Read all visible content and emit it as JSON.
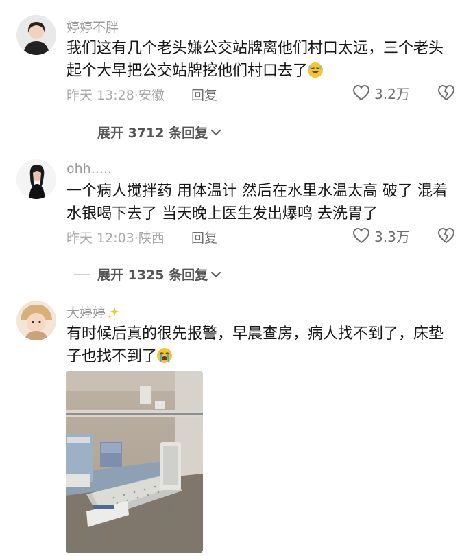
{
  "comments": [
    {
      "username": "婷婷不胖",
      "text": "我们这有几个老头嫌公交站牌离他们村口太远，三个老头起个大早把公交站牌挖他们村口去了",
      "emoji": "rofl-emoji",
      "time": "昨天 13:28",
      "location": "安徽",
      "reply_label": "回复",
      "likes": "3.2万",
      "expand_label": "展开 3712 条回复"
    },
    {
      "username": "ohh.....",
      "text": "一个病人搅拌药 用体温计 然后在水里水温太高 破了 混着水银喝下去了 当天晚上医生发出爆鸣  去洗胃了",
      "time": "昨天 12:03",
      "location": "陕西",
      "reply_label": "回复",
      "likes": "3.3万",
      "expand_label": "展开 1325 条回复"
    },
    {
      "username": "大婷婷",
      "username_decor": "sparkles-emoji",
      "text": "有时候后真的很先报警，早晨查房，病人找不到了，床垫子也找不到了",
      "emoji": "crying-emoji"
    }
  ],
  "meta_separator": "·",
  "colors": {
    "meta": "#a8a8a8",
    "text": "#161616",
    "username": "#9a9a9a"
  }
}
